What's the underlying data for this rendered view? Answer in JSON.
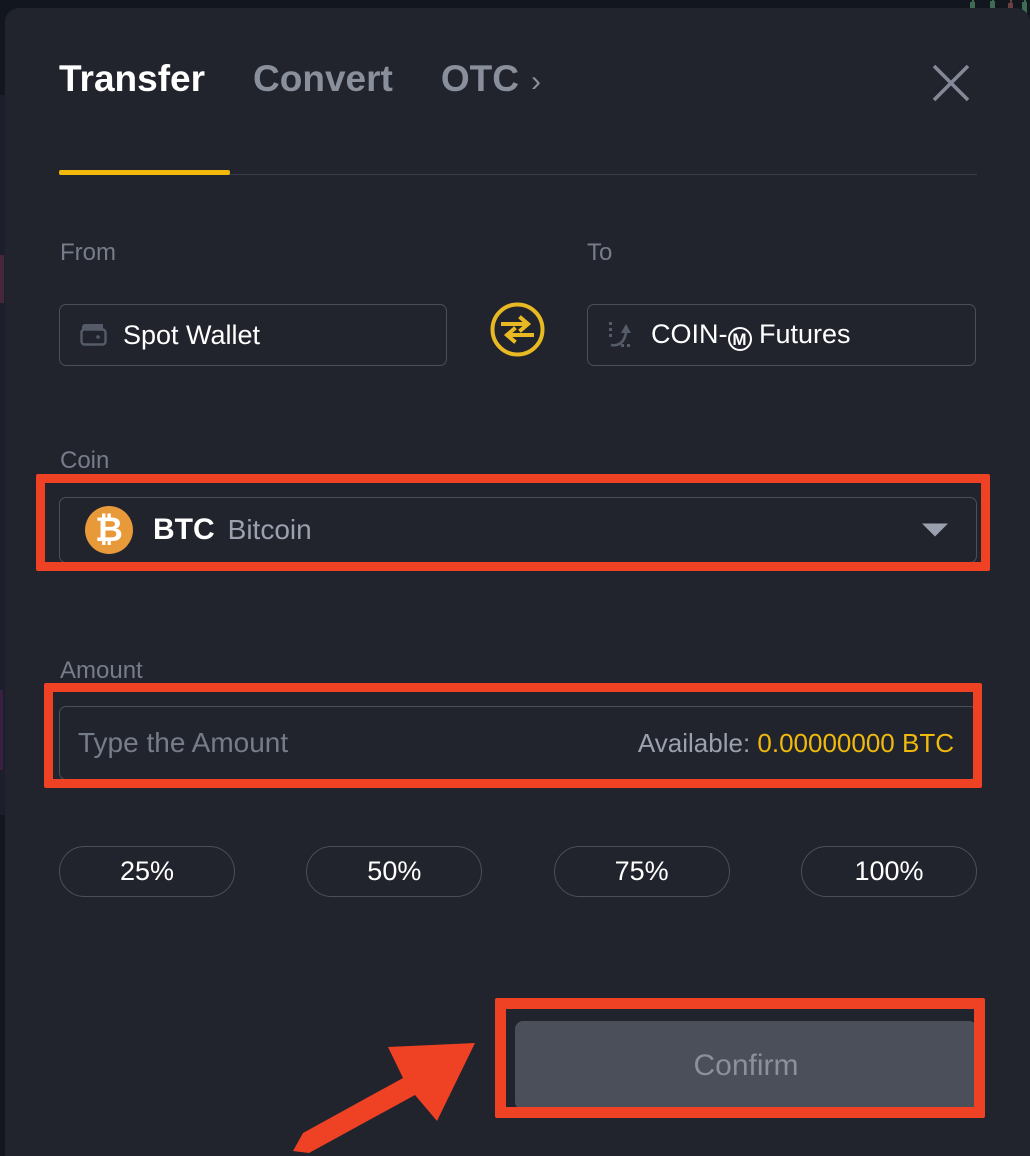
{
  "modal": {
    "tabs": [
      {
        "label": "Transfer",
        "active": true
      },
      {
        "label": "Convert",
        "active": false
      },
      {
        "label": "OTC",
        "active": false,
        "chevron": "›"
      }
    ],
    "close_icon": "close-icon",
    "accent_color": "#f0b90b",
    "annotation_color": "#ef4123"
  },
  "transfer": {
    "from": {
      "label": "From",
      "value": "Spot Wallet",
      "icon": "wallet-icon"
    },
    "to": {
      "label": "To",
      "value_prefix": "COIN-",
      "value_badge": "M",
      "value_suffix": "Futures",
      "icon": "futures-trend-icon"
    },
    "swap": {
      "icon": "swap-arrows-icon"
    },
    "coin": {
      "label": "Coin",
      "symbol": "BTC",
      "name": "Bitcoin",
      "logo_glyph": "₿",
      "logo_color": "#e8993a",
      "caret_icon": "chevron-down-icon"
    },
    "amount": {
      "label": "Amount",
      "value": "",
      "placeholder": "Type the Amount",
      "available_label": "Available:",
      "available_value": "0.00000000 BTC"
    },
    "percentages": [
      "25%",
      "50%",
      "75%",
      "100%"
    ],
    "confirm": {
      "label": "Confirm",
      "disabled": true
    }
  }
}
